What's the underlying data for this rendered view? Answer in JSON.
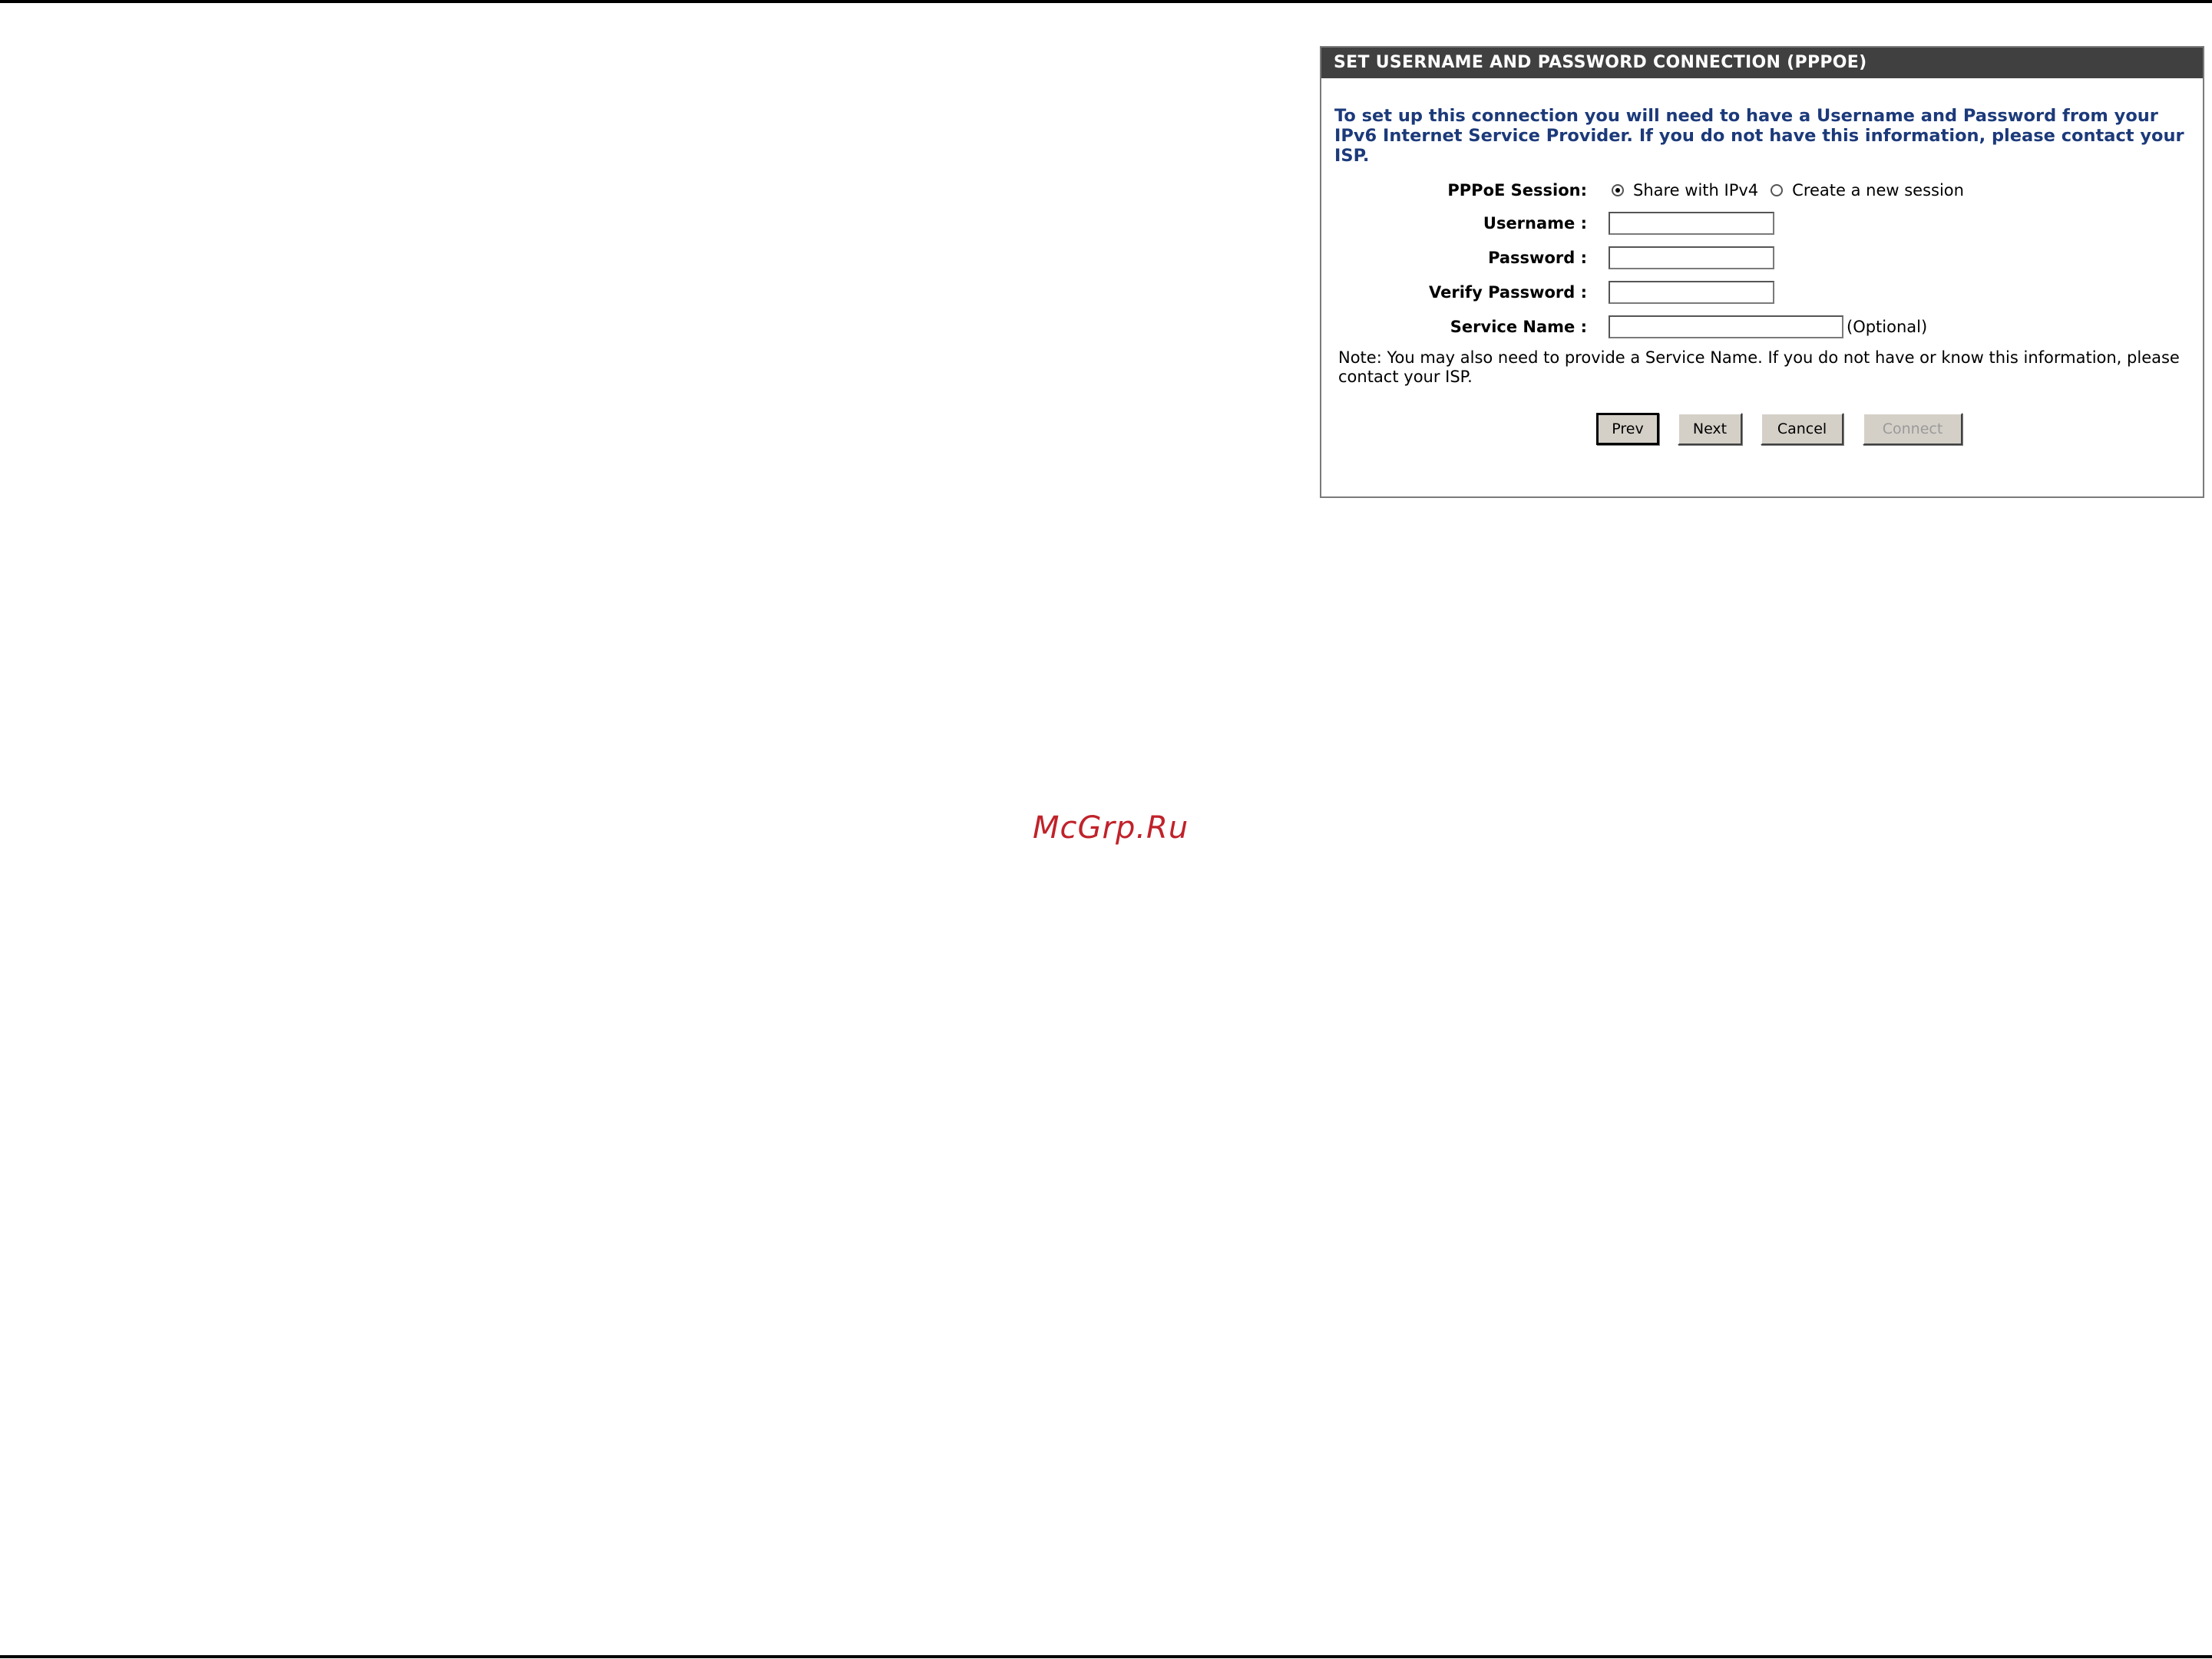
{
  "panel": {
    "title": "SET USERNAME AND PASSWORD CONNECTION (PPPOE)",
    "intro": "To set up this connection you will need to have a Username and Password from your IPv6 Internet Service Provider. If you do not have this information, please contact your ISP."
  },
  "form": {
    "pppoe_session_label": "PPPoE Session:",
    "pppoe_options": [
      "Share with IPv4",
      "Create a new session"
    ],
    "pppoe_selected": "Share with IPv4",
    "username_label": "Username :",
    "username_value": "",
    "password_label": "Password :",
    "password_value": "",
    "verify_password_label": "Verify Password :",
    "verify_password_value": "",
    "service_name_label": "Service Name :",
    "service_name_value": "",
    "service_name_hint": "(Optional)"
  },
  "note": "Note: You may also need to provide a Service Name. If you do not have or know this information, please contact your ISP.",
  "buttons": {
    "prev": "Prev",
    "next": "Next",
    "cancel": "Cancel",
    "connect": "Connect"
  },
  "watermark": "McGrp.Ru",
  "colors": {
    "header_bg": "#404040",
    "intro_text": "#1c3a7a",
    "button_face": "#d4d0c8",
    "watermark": "#c0222a"
  }
}
